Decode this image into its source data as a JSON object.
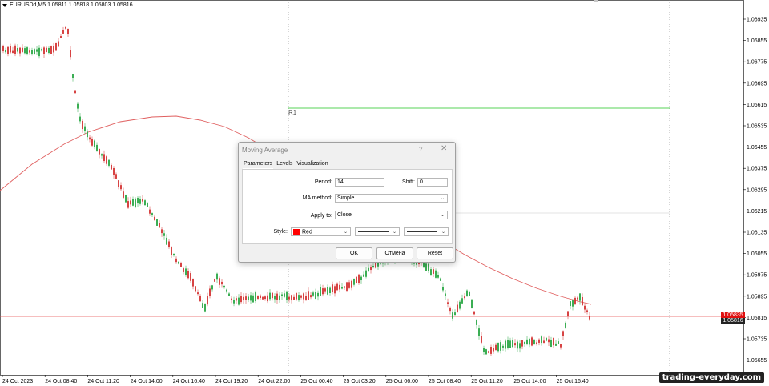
{
  "symbol": {
    "text": "EURUSDd,M5  1.05811 1.05818 1.05803 1.05816"
  },
  "price_axis": [
    "1.06935",
    "1.06855",
    "1.06775",
    "1.06695",
    "1.06615",
    "1.06535",
    "1.06455",
    "1.06375",
    "1.06295",
    "1.06215",
    "1.06135",
    "1.06055",
    "1.05975",
    "1.05895",
    "1.05815",
    "1.05735",
    "1.05655"
  ],
  "time_axis": [
    "24 Oct 2023",
    "24 Oct 08:40",
    "24 Oct 11:20",
    "24 Oct 14:00",
    "24 Oct 16:40",
    "24 Oct 19:20",
    "24 Oct 22:00",
    "25 Oct 00:40",
    "25 Oct 03:20",
    "25 Oct 06:00",
    "25 Oct 08:40",
    "25 Oct 11:20",
    "25 Oct 14:00",
    "25 Oct 16:40"
  ],
  "level_label": "R1",
  "price_badges": {
    "red": "1.05835",
    "current": "1.05816"
  },
  "watermark": "trading-everyday.com",
  "colors": {
    "bull": "#26a641",
    "bear": "#d32f2f",
    "ma": "#e06060",
    "level": "#1fc41f",
    "hline": "#e85050"
  },
  "dialog": {
    "title": "Moving Average",
    "help": "?",
    "close": "✕",
    "tabs": [
      "Parameters",
      "Levels",
      "Visualization"
    ],
    "period_label": "Period:",
    "period_value": "14",
    "shift_label": "Shift:",
    "shift_value": "0",
    "method_label": "MA method:",
    "method_value": "Simple",
    "apply_label": "Apply to:",
    "apply_value": "Close",
    "style_label": "Style:",
    "style_color": "Red",
    "ok": "OK",
    "cancel": "Отмена",
    "reset": "Reset"
  }
}
